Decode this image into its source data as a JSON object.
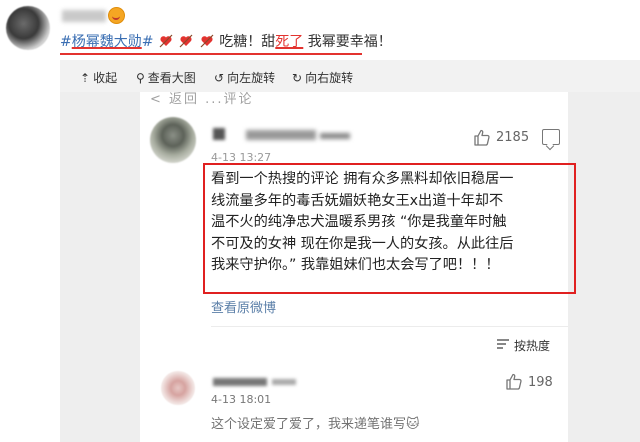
{
  "post": {
    "tag_prefix": "#",
    "tag_underlined": "杨幂魏大勋",
    "tag_suffix": "#",
    "text_sweet": "吃糖！甜",
    "text_dead": "死了",
    "text_rest": " 我幂要幸福！",
    "heart_icon": "heart-arrow-icon",
    "accent_color": "#e3332f",
    "link_color": "#3b6fb3"
  },
  "toolbar": {
    "collapse": "收起",
    "view_large": "查看大图",
    "rotate_left": "向左旋转",
    "rotate_right": "向右旋转"
  },
  "screenshot": {
    "cut_header": "< 返回        ...评论",
    "comment1": {
      "time": "4-13 13:27",
      "likes": "2185",
      "lines": [
        "看到一个热搜的评论 拥有众多黑料却依旧稳居一",
        "线流量多年的毒舌妩媚妖艳女王x出道十年却不",
        "温不火的纯净忠犬温暖系男孩 “你是我童年时触",
        "不可及的女神 现在你是我一人的女孩。从此往后",
        "我来守护你。” 我靠姐妹们也太会写了吧！！！"
      ],
      "see_original": "查看原微博",
      "highlight_color": "#e02020"
    },
    "sort_label": "按热度",
    "comment2": {
      "time": "4-13 18:01",
      "likes": "198",
      "text": "这个设定爱了爱了，我来递笔谁写🐱"
    }
  }
}
